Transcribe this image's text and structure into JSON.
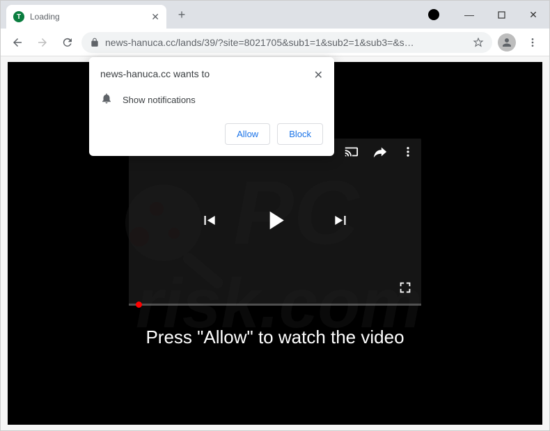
{
  "window": {
    "minimize": "—",
    "maximize": "□",
    "close": "✕"
  },
  "tab": {
    "title": "Loading",
    "favicon_letter": "T",
    "close": "✕",
    "newtab": "+"
  },
  "toolbar": {
    "url": "news-hanuca.cc/lands/39/?site=8021705&sub1=1&sub2=1&sub3=&s…"
  },
  "prompt": {
    "domain_wants_to": "news-hanuca.cc wants to",
    "message": "Show notifications",
    "allow": "Allow",
    "block": "Block",
    "close": "✕"
  },
  "page": {
    "cta": "Press \"Allow\" to watch the video"
  }
}
